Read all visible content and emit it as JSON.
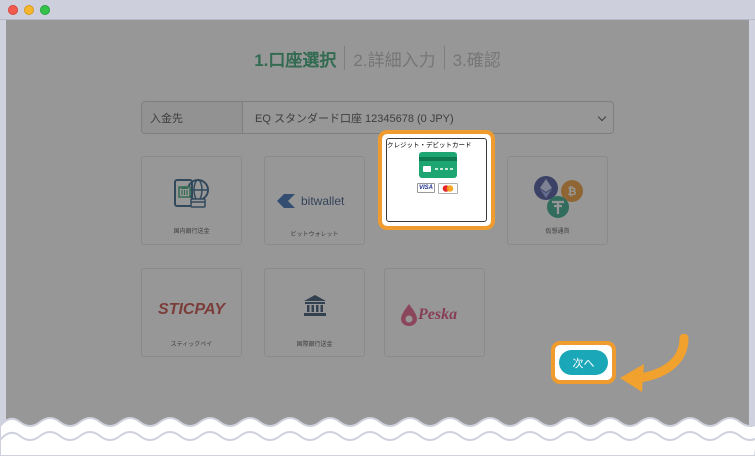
{
  "window": {
    "controls": [
      "close",
      "minimize",
      "maximize"
    ]
  },
  "steps": [
    {
      "label": "1.口座選択",
      "active": true
    },
    {
      "label": "2.詳細入力",
      "active": false
    },
    {
      "label": "3.確認",
      "active": false
    }
  ],
  "deposit": {
    "label": "入金先",
    "selected": "EQ スタンダード口座 12345678 (0 JPY)"
  },
  "methods": {
    "domestic_bank": {
      "label": "国内銀行送金",
      "icon": "bank-card-globe-icon"
    },
    "bitwallet": {
      "label": "ビットウォレット",
      "brand": "bitwallet",
      "icon": "bitwallet-logo"
    },
    "credit_card": {
      "label": "クレジット・デビットカード",
      "icon": "credit-card-icon",
      "brands": [
        "VISA",
        "mastercard"
      ]
    },
    "crypto": {
      "label": "仮想通貨",
      "icon": "crypto-coins-icon"
    },
    "sticpay": {
      "label": "スティックペイ",
      "brand": "STICPAY"
    },
    "intl_bank": {
      "label": "国際銀行送金",
      "icon": "bank-building-icon"
    },
    "pesska": {
      "label": "",
      "brand": "Peska"
    }
  },
  "next_button": {
    "label": "次へ"
  },
  "colors": {
    "accent_green": "#1b9a63",
    "highlight_orange": "#ef9b2e",
    "next_teal": "#1aa7b8"
  }
}
